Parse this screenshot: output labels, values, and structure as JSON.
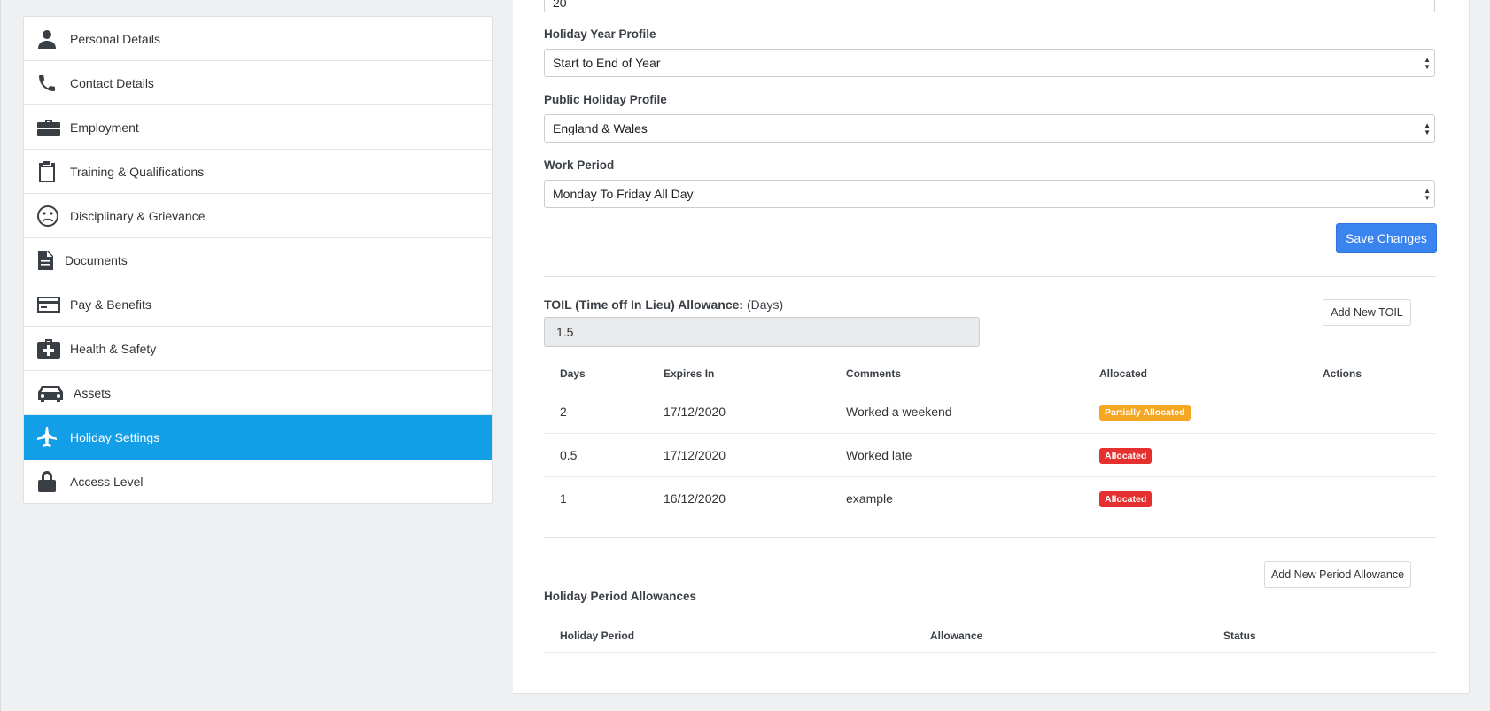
{
  "sidebar": {
    "items": [
      {
        "label": "Personal Details",
        "icon": "person-icon"
      },
      {
        "label": "Contact Details",
        "icon": "phone-icon"
      },
      {
        "label": "Employment",
        "icon": "briefcase-icon"
      },
      {
        "label": "Training & Qualifications",
        "icon": "clipboard-icon"
      },
      {
        "label": "Disciplinary & Grievance",
        "icon": "sad-face-icon"
      },
      {
        "label": "Documents",
        "icon": "document-icon"
      },
      {
        "label": "Pay & Benefits",
        "icon": "credit-card-icon"
      },
      {
        "label": "Health & Safety",
        "icon": "medical-kit-icon"
      },
      {
        "label": "Assets",
        "icon": "car-icon"
      },
      {
        "label": "Holiday Settings",
        "icon": "airplane-icon",
        "active": true
      },
      {
        "label": "Access Level",
        "icon": "lock-icon"
      }
    ],
    "active_color": "#139ee8"
  },
  "form": {
    "top_input_value": "20",
    "holiday_year_profile": {
      "label": "Holiday Year Profile",
      "value": "Start to End of Year"
    },
    "public_holiday_profile": {
      "label": "Public Holiday Profile",
      "value": "England & Wales"
    },
    "work_period": {
      "label": "Work Period",
      "value": "Monday To Friday All Day"
    },
    "save_label": "Save Changes",
    "primary_color": "#3a84f0"
  },
  "toil": {
    "label_bold": "TOIL (Time off In Lieu) Allowance:",
    "label_unit": "(Days)",
    "value": "1.5",
    "add_label": "Add New TOIL",
    "columns": [
      "Days",
      "Expires In",
      "Comments",
      "Allocated",
      "Actions"
    ],
    "rows": [
      {
        "days": "2",
        "expires": "17/12/2020",
        "comment": "Worked a weekend",
        "status": "Partially Allocated",
        "status_color": "#f5a623"
      },
      {
        "days": "0.5",
        "expires": "17/12/2020",
        "comment": "Worked late",
        "status": "Allocated",
        "status_color": "#e63030"
      },
      {
        "days": "1",
        "expires": "16/12/2020",
        "comment": "example",
        "status": "Allocated",
        "status_color": "#e63030"
      }
    ]
  },
  "period_allowances": {
    "add_label": "Add New Period Allowance",
    "title": "Holiday Period Allowances",
    "columns": [
      "Holiday Period",
      "Allowance",
      "Status"
    ]
  }
}
